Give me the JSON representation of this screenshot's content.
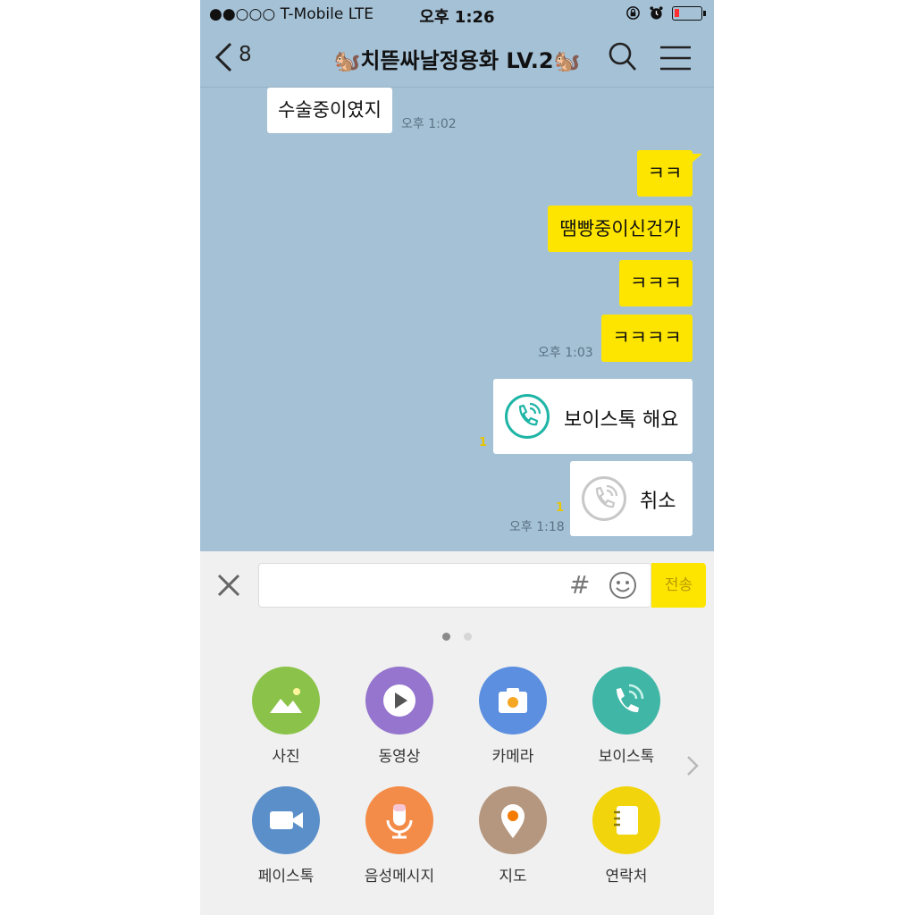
{
  "status_bar": {
    "carrier": "●●○○○ T-Mobile   LTE",
    "time": "오후 1:26"
  },
  "header": {
    "back_count": "8",
    "title": "🐿️치뜯싸날정용화 LV.2🐿️"
  },
  "messages": {
    "m1": {
      "text": "수술중이였지",
      "time": "오후 1:02"
    },
    "m2": {
      "text": "ㅋㅋ"
    },
    "m3": {
      "text": "땜빵중이신건가"
    },
    "m4": {
      "text": "ㅋㅋㅋ"
    },
    "m5": {
      "text": "ㅋㅋㅋㅋ",
      "time": "오후 1:03"
    },
    "m6": {
      "text": "보이스톡 해요",
      "unread": "1",
      "icon": "voice-call-icon",
      "color": "#1fb5a6"
    },
    "m7": {
      "text": "취소",
      "unread": "1",
      "time": "오후 1:18",
      "icon": "voice-call-cancel-icon",
      "color": "#c8c8c8"
    }
  },
  "input": {
    "value": "",
    "hash": "#",
    "send_label": "전송"
  },
  "tools": [
    {
      "label": "사진",
      "icon": "photo-icon",
      "color": "#8bc34a"
    },
    {
      "label": "동영상",
      "icon": "video-play-icon",
      "color": "#9575cd"
    },
    {
      "label": "카메라",
      "icon": "camera-icon",
      "color": "#5c8fe0"
    },
    {
      "label": "보이스톡",
      "icon": "voice-talk-icon",
      "color": "#3fb6a6"
    },
    {
      "label": "페이스톡",
      "icon": "face-talk-icon",
      "color": "#5b8fc9"
    },
    {
      "label": "음성메시지",
      "icon": "microphone-icon",
      "color": "#f48c49"
    },
    {
      "label": "지도",
      "icon": "map-pin-icon",
      "color": "#b5977f"
    },
    {
      "label": "연락처",
      "icon": "contacts-icon",
      "color": "#f2d40c"
    }
  ],
  "colors": {
    "chat_background": "#a5c1d6",
    "my_bubble": "#fee500",
    "their_bubble": "#ffffff",
    "unread_badge": "#e6c400"
  }
}
